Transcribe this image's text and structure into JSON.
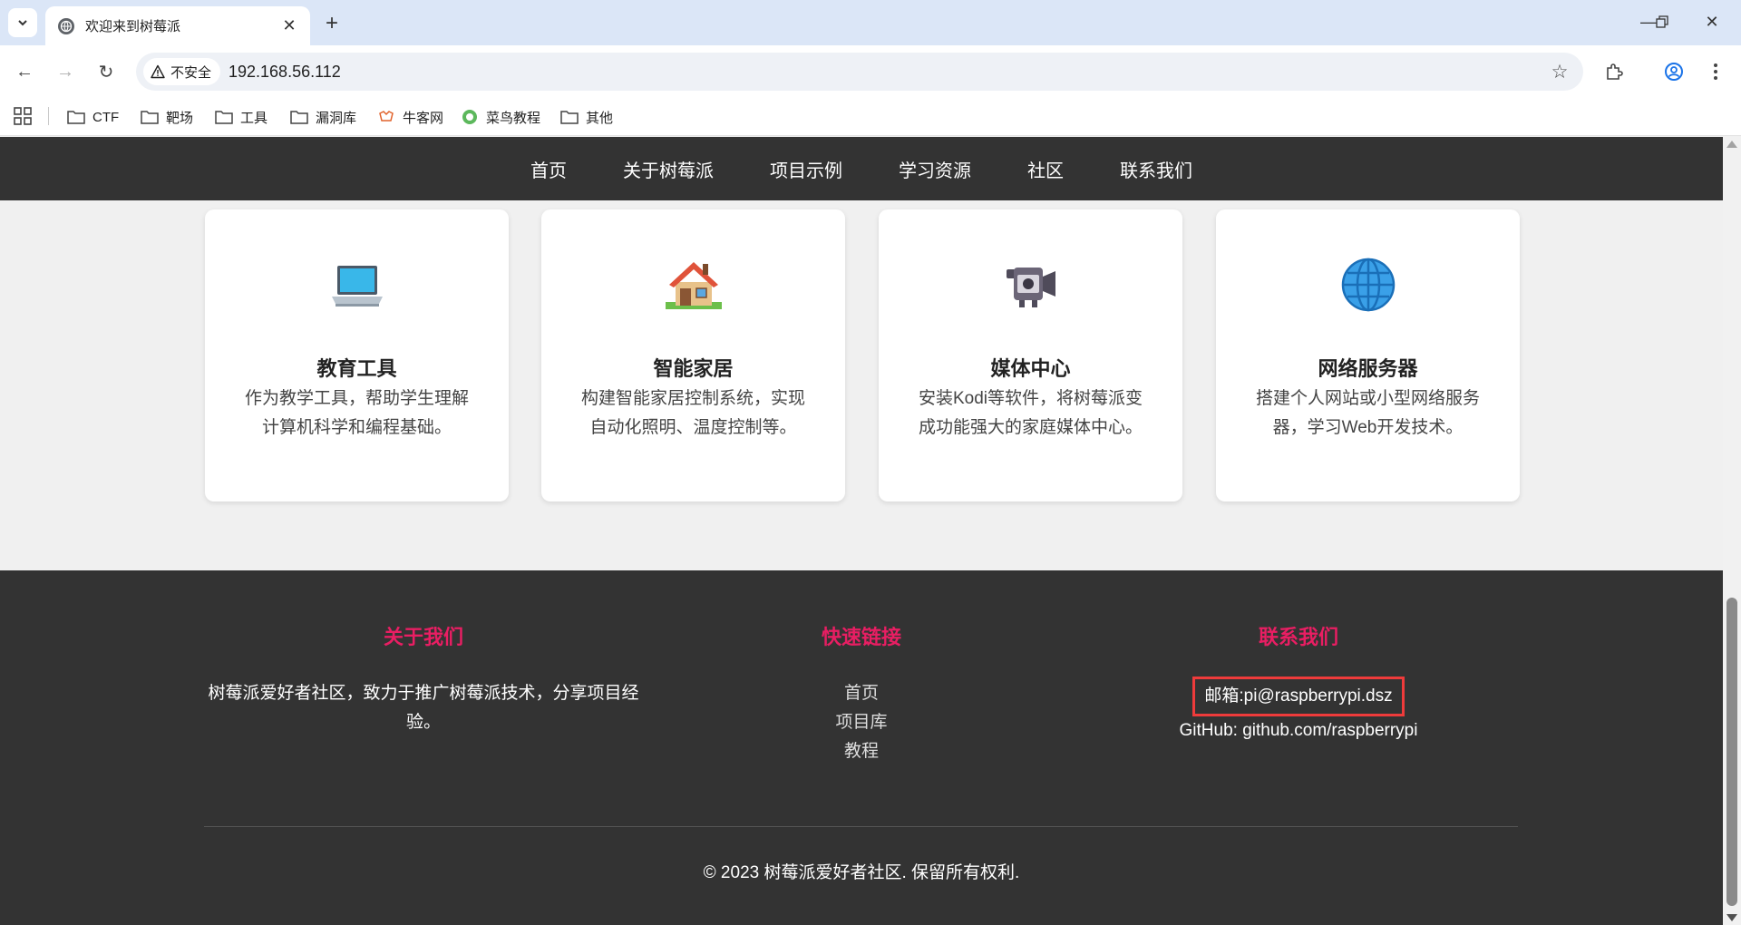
{
  "browser": {
    "tab_title": "欢迎来到树莓派",
    "new_tab_symbol": "+",
    "security_label": "不安全",
    "url": "192.168.56.112",
    "bookmarks": [
      {
        "label": "CTF",
        "icon": "folder-icon"
      },
      {
        "label": "靶场",
        "icon": "folder-icon"
      },
      {
        "label": "工具",
        "icon": "folder-icon"
      },
      {
        "label": "漏洞库",
        "icon": "folder-icon"
      },
      {
        "label": "牛客网",
        "icon": "nowcoder-icon"
      },
      {
        "label": "菜鸟教程",
        "icon": "runoob-icon"
      },
      {
        "label": "其他",
        "icon": "folder-icon"
      }
    ]
  },
  "nav": {
    "items": [
      "首页",
      "关于树莓派",
      "项目示例",
      "学习资源",
      "社区",
      "联系我们"
    ]
  },
  "cards": [
    {
      "icon": "laptop-icon",
      "title": "教育工具",
      "text": "作为教学工具，帮助学生理解计算机科学和编程基础。"
    },
    {
      "icon": "house-icon",
      "title": "智能家居",
      "text": "构建智能家居控制系统，实现自动化照明、温度控制等。"
    },
    {
      "icon": "video-camera-icon",
      "title": "媒体中心",
      "text": "安装Kodi等软件，将树莓派变成功能强大的家庭媒体中心。"
    },
    {
      "icon": "globe-icon",
      "title": "网络服务器",
      "text": "搭建个人网站或小型网络服务器，学习Web开发技术。"
    }
  ],
  "footer": {
    "about": {
      "heading": "关于我们",
      "text": "树莓派爱好者社区，致力于推广树莓派技术，分享项目经验。"
    },
    "links": {
      "heading": "快速链接",
      "items": [
        "首页",
        "项目库",
        "教程"
      ]
    },
    "contact": {
      "heading": "联系我们",
      "email": "邮箱:pi@raspberrypi.dsz",
      "github": "GitHub: github.com/raspberrypi"
    },
    "copyright": "© 2023 树莓派爱好者社区. 保留所有权利."
  },
  "colors": {
    "accent": "#e91e63",
    "nav_bg": "#333333",
    "highlight_box": "#ef3b3b"
  }
}
